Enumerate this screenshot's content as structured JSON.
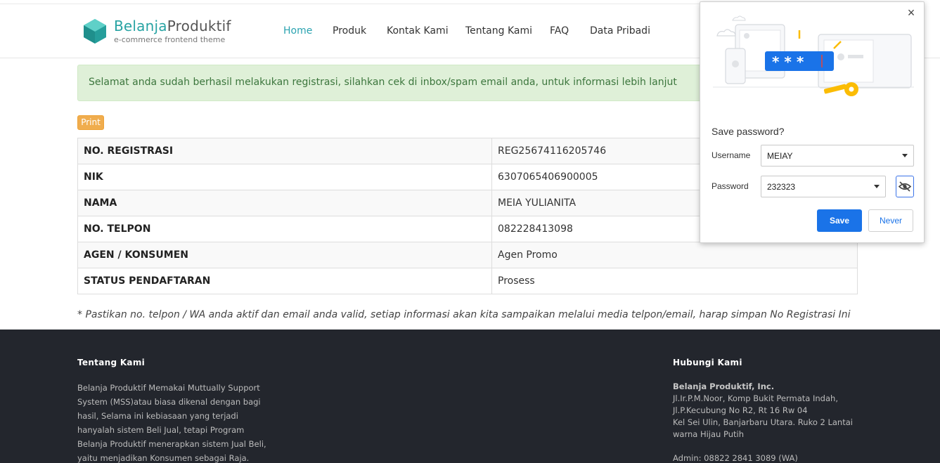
{
  "header": {
    "brand_part1": "Belanja",
    "brand_part2": "Produktif",
    "tagline": "e-commerce frontend theme",
    "nav": [
      "Home",
      "Produk",
      "Kontak Kami",
      "Tentang Kami",
      "FAQ",
      "Data Pribadi"
    ],
    "active_nav": "Home",
    "accent_color": "#27a3a3"
  },
  "alert": {
    "message": "Selamat anda sudah berhasil melakukan registrasi, silahkan cek di inbox/spam email anda, untuk informasi lebih lanjut"
  },
  "print_label": "Print",
  "registration": [
    {
      "label": "NO. REGISTRASI",
      "value": "REG25674116205746"
    },
    {
      "label": "NIK",
      "value": "6307065406900005"
    },
    {
      "label": "NAMA",
      "value": "MEIA YULIANITA"
    },
    {
      "label": "NO. TELPON",
      "value": "082228413098"
    },
    {
      "label": "AGEN / KONSUMEN",
      "value": "Agen Promo"
    },
    {
      "label": "STATUS PENDAFTARAN",
      "value": "Prosess"
    }
  ],
  "note": "* Pastikan no. telpon / WA anda aktif dan email anda valid, setiap informasi akan kita sampaikan melalui media telpon/email, harap simpan No Registrasi Ini",
  "footer": {
    "about_title": "Tentang Kami",
    "about_lines": [
      "Belanja Produktif Memakai Muttually Support",
      "System (MSS)atau biasa dikenal dengan bagi",
      "hasil, Selama ini kebiasaan yang terjadi",
      "hanyalah sistem Beli Jual, tetapi Program",
      "Belanja Produktif menerapkan sistem Jual Beli,",
      "yaitu menjadikan Konsumen sebagai Raja."
    ],
    "contact_title": "Hubungi Kami",
    "company": "Belanja Produktif, Inc.",
    "address_lines": [
      "Jl.Ir.P.M.Noor, Komp Bukit Permata Indah,",
      "Jl.P.Kecubung No R2, Rt 16 Rw 04",
      "Kel Sei Ulin, Banjarbaru Utara. Ruko 2 Lantai",
      "warna Hijau Putih"
    ],
    "admin": "Admin: 08822 2841 3089 (WA)"
  },
  "password_prompt": {
    "title": "Save password?",
    "username_label": "Username",
    "username_value": "MEIAY",
    "password_label": "Password",
    "password_value": "232323",
    "masked_text": "* * *",
    "save_label": "Save",
    "never_label": "Never",
    "close_glyph": "×",
    "button_color": "#1a73e8"
  }
}
